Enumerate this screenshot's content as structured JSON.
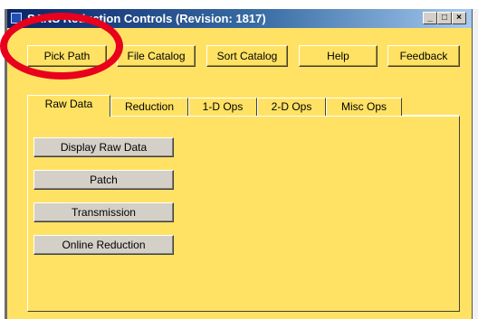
{
  "window": {
    "title": "SANS Reduction Controls (Revision: 1817)",
    "controls": {
      "minimize": "_",
      "maximize": "□",
      "close": "×"
    }
  },
  "toolbar": {
    "pick_path": "Pick Path",
    "file_catalog": "File Catalog",
    "sort_catalog": "Sort Catalog",
    "help": "Help",
    "feedback": "Feedback"
  },
  "tabs": [
    "Raw Data",
    "Reduction",
    "1-D Ops",
    "2-D Ops",
    "Misc Ops"
  ],
  "raw_data_panel": {
    "buttons": [
      "Display Raw Data",
      "Patch",
      "Transmission",
      "Online Reduction"
    ]
  },
  "annotation": {
    "color": "#e8001c"
  }
}
